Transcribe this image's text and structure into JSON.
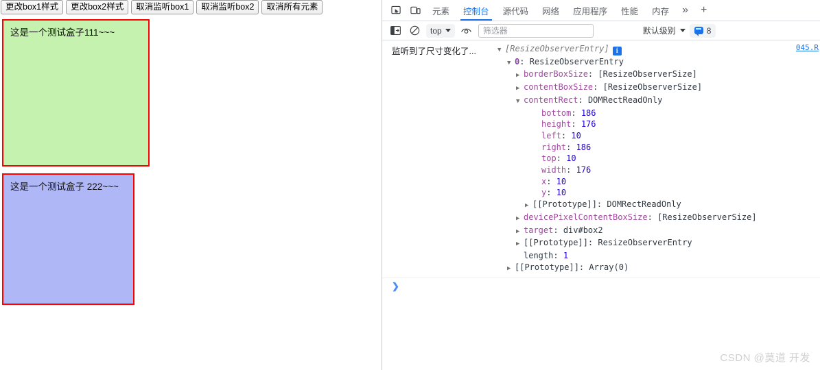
{
  "page": {
    "buttons": [
      {
        "label": "更改box1样式",
        "name": "change-box1-style-button"
      },
      {
        "label": "更改box2样式",
        "name": "change-box2-style-button"
      },
      {
        "label": "取消监听box1",
        "name": "unobserve-box1-button"
      },
      {
        "label": "取消监听box2",
        "name": "unobserve-box2-button"
      },
      {
        "label": "取消所有元素",
        "name": "disconnect-all-button"
      }
    ],
    "box1": {
      "text": "这是一个测试盒子111~~~",
      "background": "#c5f2ae",
      "border_color": "#ff0000"
    },
    "box2": {
      "text": "这是一个测试盒子 222~~~",
      "background": "#afb7f7",
      "border_color": "#ff0000"
    }
  },
  "devtools": {
    "tabs": [
      {
        "label": "元素",
        "active": false
      },
      {
        "label": "控制台",
        "active": true
      },
      {
        "label": "源代码",
        "active": false
      },
      {
        "label": "网络",
        "active": false
      },
      {
        "label": "应用程序",
        "active": false
      },
      {
        "label": "性能",
        "active": false
      },
      {
        "label": "内存",
        "active": false
      }
    ],
    "tab_overflow": "»",
    "tab_add": "+",
    "icons": {
      "inspect": "inspect-element-icon",
      "device": "device-toolbar-icon",
      "sidebar": "console-sidebar-icon",
      "clear": "clear-console-icon",
      "eye": "live-expression-icon"
    },
    "toolbar": {
      "context": "top",
      "filter_placeholder": "筛选器",
      "filter_value": "",
      "level": "默认级别",
      "message_count": "8"
    },
    "console": {
      "source_link": "045.R",
      "log_label": "监听到了尺寸变化了...",
      "root_preview": "[ResizeObserverEntry]",
      "nodes": [
        {
          "indent": 2,
          "arrow": "open",
          "key": "0",
          "key_style": "index",
          "value": "ResizeObserverEntry",
          "value_style": "plain"
        },
        {
          "indent": 3,
          "arrow": "closed",
          "key": "borderBoxSize",
          "key_style": "prop",
          "value": "[ResizeObserverSize]",
          "value_style": "plain"
        },
        {
          "indent": 3,
          "arrow": "closed",
          "key": "contentBoxSize",
          "key_style": "prop",
          "value": "[ResizeObserverSize]",
          "value_style": "plain"
        },
        {
          "indent": 3,
          "arrow": "open",
          "key": "contentRect",
          "key_style": "prop",
          "value": "DOMRectReadOnly",
          "value_style": "plain"
        },
        {
          "indent": 5,
          "arrow": "none",
          "key": "bottom",
          "key_style": "prop",
          "value": "186",
          "value_style": "num"
        },
        {
          "indent": 5,
          "arrow": "none",
          "key": "height",
          "key_style": "prop",
          "value": "176",
          "value_style": "num"
        },
        {
          "indent": 5,
          "arrow": "none",
          "key": "left",
          "key_style": "prop",
          "value": "10",
          "value_style": "num"
        },
        {
          "indent": 5,
          "arrow": "none",
          "key": "right",
          "key_style": "prop",
          "value": "186",
          "value_style": "num"
        },
        {
          "indent": 5,
          "arrow": "none",
          "key": "top",
          "key_style": "prop",
          "value": "10",
          "value_style": "num"
        },
        {
          "indent": 5,
          "arrow": "none",
          "key": "width",
          "key_style": "prop",
          "value": "176",
          "value_style": "num"
        },
        {
          "indent": 5,
          "arrow": "none",
          "key": "x",
          "key_style": "prop",
          "value": "10",
          "value_style": "num"
        },
        {
          "indent": 5,
          "arrow": "none",
          "key": "y",
          "key_style": "prop",
          "value": "10",
          "value_style": "num"
        },
        {
          "indent": 4,
          "arrow": "closed",
          "key": "[[Prototype]]",
          "key_style": "own",
          "value": "DOMRectReadOnly",
          "value_style": "plain"
        },
        {
          "indent": 3,
          "arrow": "closed",
          "key": "devicePixelContentBoxSize",
          "key_style": "prop",
          "value": "[ResizeObserverSize]",
          "value_style": "plain"
        },
        {
          "indent": 3,
          "arrow": "closed",
          "key": "target",
          "key_style": "prop",
          "value": "div#box2",
          "value_style": "plain"
        },
        {
          "indent": 3,
          "arrow": "closed",
          "key": "[[Prototype]]",
          "key_style": "own",
          "value": "ResizeObserverEntry",
          "value_style": "plain"
        },
        {
          "indent": 3,
          "arrow": "none",
          "key": "length",
          "key_style": "own",
          "value": "1",
          "value_style": "num"
        },
        {
          "indent": 2,
          "arrow": "closed",
          "key": "[[Prototype]]",
          "key_style": "own",
          "value": "Array(0)",
          "value_style": "plain"
        }
      ],
      "prompt_chevron": "❯",
      "prompt_value": ""
    }
  },
  "watermark": "CSDN @莫道 开发"
}
